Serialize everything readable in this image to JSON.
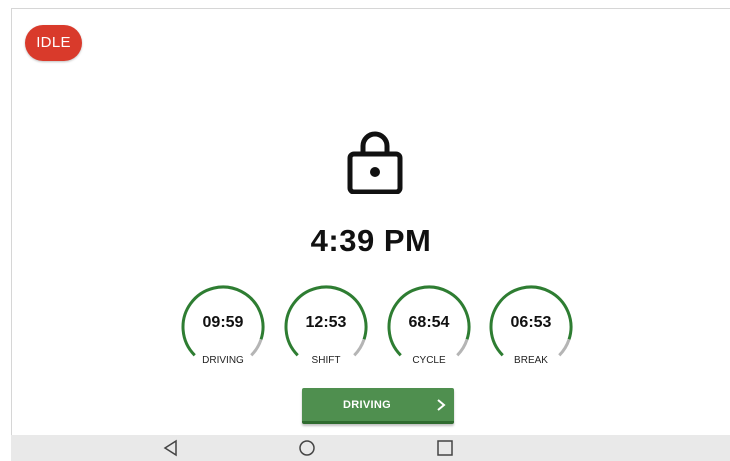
{
  "status": {
    "label": "IDLE",
    "color": "#d93a2b"
  },
  "lock": {
    "icon": "lock-icon"
  },
  "clock": {
    "time": "4:39 PM"
  },
  "timers": [
    {
      "value": "09:59",
      "label": "DRIVING",
      "progress": 0.9
    },
    {
      "value": "12:53",
      "label": "SHIFT",
      "progress": 0.9
    },
    {
      "value": "68:54",
      "label": "CYCLE",
      "progress": 0.9
    },
    {
      "value": "06:53",
      "label": "BREAK",
      "progress": 0.9
    }
  ],
  "colors": {
    "ring_active": "#2e7d32",
    "ring_remaining": "#b5b5b5",
    "button": "#4f8f4f"
  },
  "drive_button": {
    "label": "DRIVING",
    "icon": "chevron-right-icon"
  },
  "navbar": {
    "back_icon": "back-triangle-icon",
    "home_icon": "home-circle-icon",
    "recents_icon": "recents-square-icon"
  }
}
